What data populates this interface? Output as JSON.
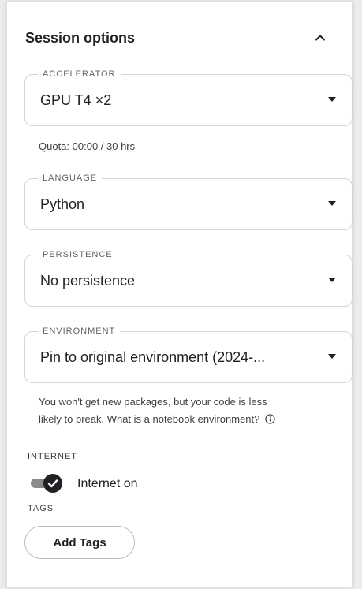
{
  "panel": {
    "title": "Session options"
  },
  "accelerator": {
    "label": "ACCELERATOR",
    "value": "GPU T4 ×2",
    "quota": "Quota: 00:00 / 30 hrs"
  },
  "language": {
    "label": "LANGUAGE",
    "value": "Python"
  },
  "persistence": {
    "label": "PERSISTENCE",
    "value": "No persistence"
  },
  "environment": {
    "label": "ENVIRONMENT",
    "value": "Pin to original environment (2024-...",
    "help_line1": "You won't get new packages, but your code is less",
    "help_line2": "likely to break. What is a notebook environment?"
  },
  "internet": {
    "label": "INTERNET",
    "toggle_label": "Internet on",
    "enabled": true
  },
  "tags": {
    "label": "TAGS",
    "button_label": "Add Tags"
  },
  "icons": {
    "collapse": "chevron-up-icon",
    "dropdown": "caret-down-icon",
    "info": "info-icon",
    "check": "check-icon"
  },
  "colors": {
    "text": "#202124",
    "toggle_track": "#8a8a8a",
    "toggle_knob": "#202124",
    "border": "#d4d4d4"
  }
}
